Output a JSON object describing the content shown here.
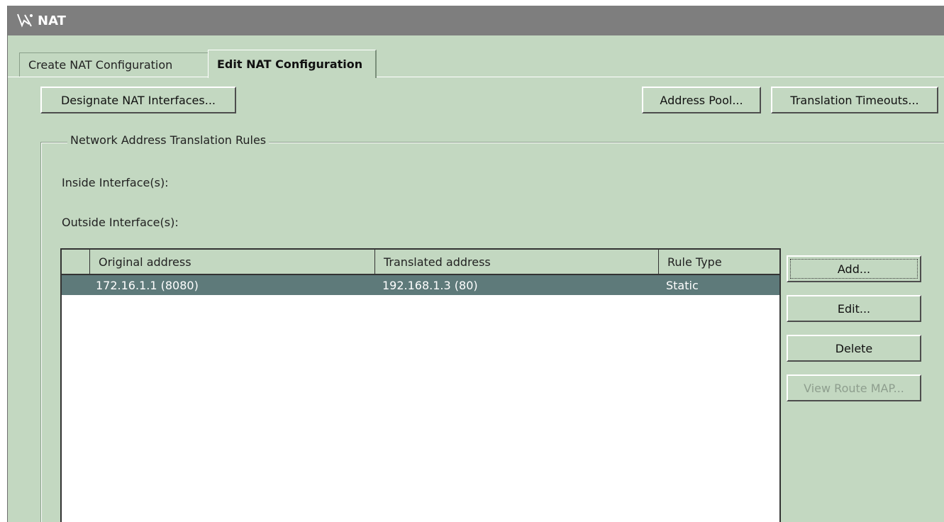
{
  "window": {
    "title": "NAT",
    "icon": "nat-wand-icon"
  },
  "tabs": [
    {
      "label": "Create NAT Configuration",
      "active": false
    },
    {
      "label": "Edit NAT Configuration",
      "active": true
    }
  ],
  "toolbar": {
    "designate_label": "Designate NAT Interfaces...",
    "address_pool_label": "Address Pool...",
    "timeouts_label": "Translation Timeouts..."
  },
  "rules": {
    "group_title": "Network Address Translation Rules",
    "inside_label": "Inside Interface(s):",
    "outside_label": "Outside Interface(s):",
    "columns": [
      "",
      "Original address",
      "Translated address",
      "Rule Type"
    ],
    "rows": [
      {
        "original": "172.16.1.1 (8080)",
        "translated": "192.168.1.3 (80)",
        "type": "Static",
        "selected": true
      }
    ],
    "buttons": {
      "add": "Add...",
      "edit": "Edit...",
      "delete": "Delete",
      "view_route_map": "View Route MAP..."
    }
  },
  "colors": {
    "panel_bg": "#c3d8c1",
    "titlebar_bg": "#7e7e7e",
    "selected_row_bg": "#5e7a7a"
  }
}
